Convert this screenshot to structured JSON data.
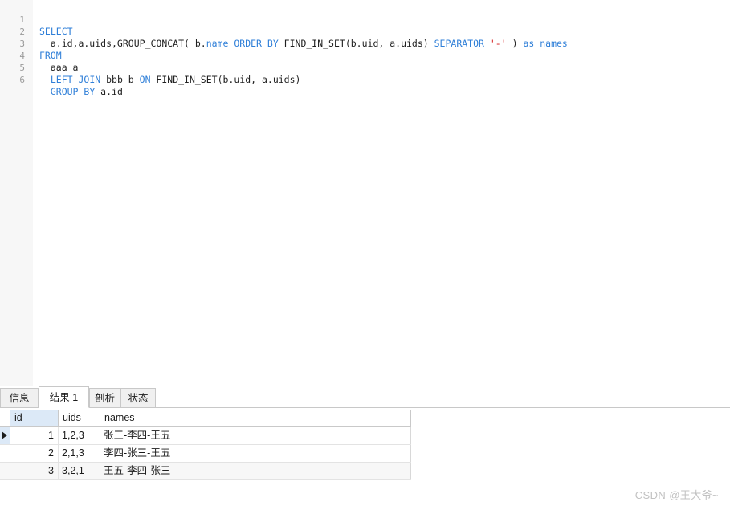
{
  "editor": {
    "line_numbers": [
      "1",
      "2",
      "3",
      "4",
      "5",
      "6"
    ],
    "lines": [
      {
        "n": "1",
        "text": "SELECT"
      },
      {
        "n": "2",
        "text": "  a.id,a.uids,GROUP_CONCAT( b.name ORDER BY FIND_IN_SET(b.uid, a.uids) SEPARATOR '-' ) as names"
      },
      {
        "n": "3",
        "text": "FROM"
      },
      {
        "n": "4",
        "text": "  aaa a"
      },
      {
        "n": "5",
        "text": "  LEFT JOIN bbb b ON FIND_IN_SET(b.uid, a.uids)"
      },
      {
        "n": "6",
        "text": "  GROUP BY a.id"
      }
    ],
    "colors": {
      "keyword": "#2f7fd8",
      "string": "#d42020",
      "text": "#202020",
      "line_number": "#9a9a9a",
      "gutter_bg": "#f7f7f7"
    }
  },
  "result_panel": {
    "tabs": [
      {
        "label": "信息",
        "active": false
      },
      {
        "label": "结果 1",
        "active": true
      },
      {
        "label": "剖析",
        "active": false
      },
      {
        "label": "状态",
        "active": false
      }
    ],
    "grid": {
      "columns": [
        "id",
        "uids",
        "names"
      ],
      "selected_column": "id",
      "rows": [
        {
          "id": "1",
          "uids": "1,2,3",
          "names": "张三-李四-王五"
        },
        {
          "id": "2",
          "uids": "2,1,3",
          "names": "李四-张三-王五"
        },
        {
          "id": "3",
          "uids": "3,2,1",
          "names": "王五-李四-张三"
        }
      ],
      "selected_row_index": 0,
      "selection_indicator": "row-selected-arrow"
    }
  },
  "watermark": {
    "text": "CSDN @王大爷~",
    "color": "#c2c2c2"
  }
}
